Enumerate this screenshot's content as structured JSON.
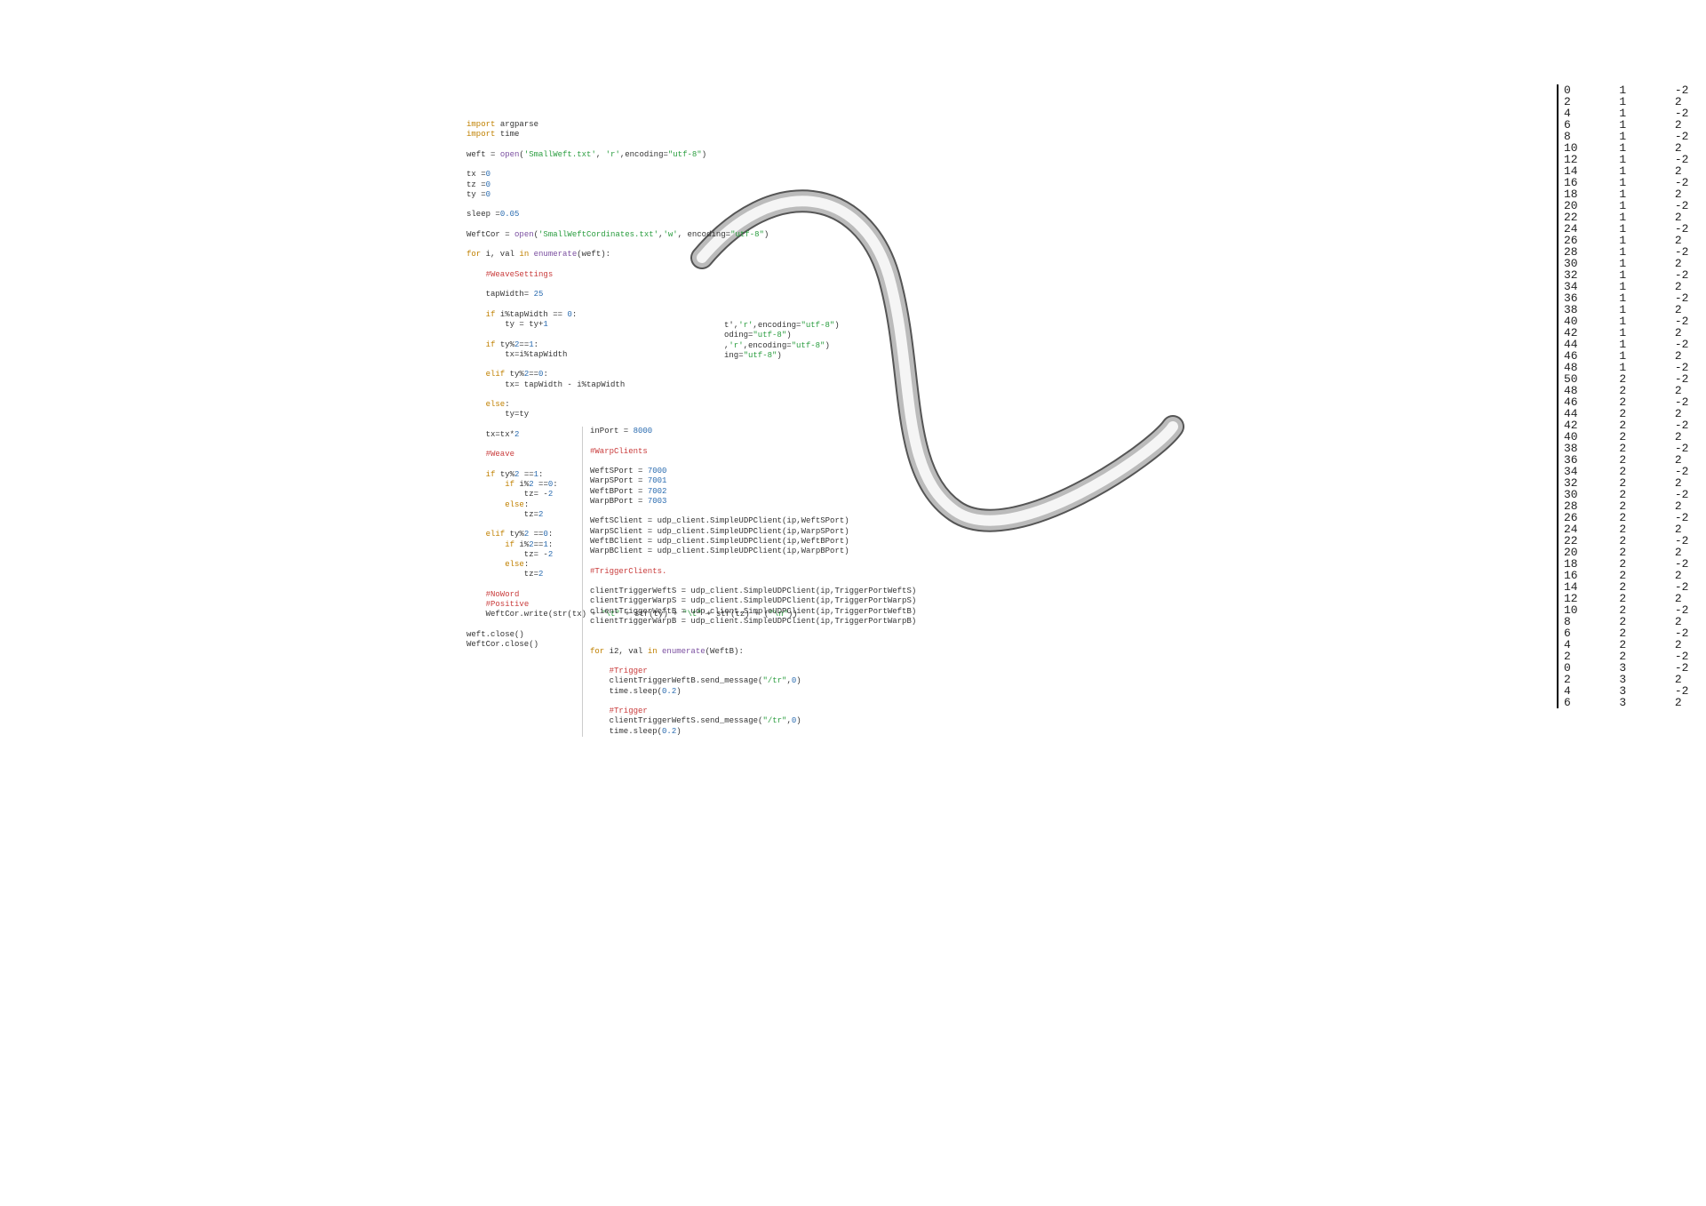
{
  "code_left": {
    "lines": [
      {
        "segs": [
          {
            "t": "import ",
            "c": "kw"
          },
          {
            "t": "argparse"
          }
        ]
      },
      {
        "segs": [
          {
            "t": "import ",
            "c": "kw"
          },
          {
            "t": "time"
          }
        ]
      },
      {
        "segs": [
          {
            "t": ""
          }
        ]
      },
      {
        "segs": [
          {
            "t": "weft = "
          },
          {
            "t": "open",
            "c": "fn"
          },
          {
            "t": "("
          },
          {
            "t": "'SmallWeft.txt'",
            "c": "st"
          },
          {
            "t": ", "
          },
          {
            "t": "'r'",
            "c": "st"
          },
          {
            "t": ",encoding="
          },
          {
            "t": "\"utf-8\"",
            "c": "st"
          },
          {
            "t": ")"
          }
        ]
      },
      {
        "segs": [
          {
            "t": ""
          }
        ]
      },
      {
        "segs": [
          {
            "t": "tx ="
          },
          {
            "t": "0",
            "c": "nm"
          }
        ]
      },
      {
        "segs": [
          {
            "t": "tz ="
          },
          {
            "t": "0",
            "c": "nm"
          }
        ]
      },
      {
        "segs": [
          {
            "t": "ty ="
          },
          {
            "t": "0",
            "c": "nm"
          }
        ]
      },
      {
        "segs": [
          {
            "t": ""
          }
        ]
      },
      {
        "segs": [
          {
            "t": "sleep ="
          },
          {
            "t": "0.05",
            "c": "nm"
          }
        ]
      },
      {
        "segs": [
          {
            "t": ""
          }
        ]
      },
      {
        "segs": [
          {
            "t": "WeftCor = "
          },
          {
            "t": "open",
            "c": "fn"
          },
          {
            "t": "("
          },
          {
            "t": "'SmallWeftCordinates.txt'",
            "c": "st"
          },
          {
            "t": ","
          },
          {
            "t": "'w'",
            "c": "st"
          },
          {
            "t": ", encoding="
          },
          {
            "t": "\"utf-8\"",
            "c": "st"
          },
          {
            "t": ")"
          }
        ]
      },
      {
        "segs": [
          {
            "t": ""
          }
        ]
      },
      {
        "segs": [
          {
            "t": "for ",
            "c": "kw"
          },
          {
            "t": "i, val "
          },
          {
            "t": "in ",
            "c": "kw"
          },
          {
            "t": "enumerate",
            "c": "fn"
          },
          {
            "t": "(weft):"
          }
        ]
      },
      {
        "segs": [
          {
            "t": ""
          }
        ]
      },
      {
        "segs": [
          {
            "t": "    "
          },
          {
            "t": "#WeaveSettings",
            "c": "cm"
          }
        ]
      },
      {
        "segs": [
          {
            "t": ""
          }
        ]
      },
      {
        "segs": [
          {
            "t": "    tapWidth= "
          },
          {
            "t": "25",
            "c": "nm"
          }
        ]
      },
      {
        "segs": [
          {
            "t": ""
          }
        ]
      },
      {
        "segs": [
          {
            "t": "    "
          },
          {
            "t": "if ",
            "c": "kw"
          },
          {
            "t": "i%tapWidth == "
          },
          {
            "t": "0",
            "c": "nm"
          },
          {
            "t": ":"
          }
        ]
      },
      {
        "segs": [
          {
            "t": "        ty = ty+"
          },
          {
            "t": "1",
            "c": "nm"
          }
        ]
      },
      {
        "segs": [
          {
            "t": ""
          }
        ]
      },
      {
        "segs": [
          {
            "t": "    "
          },
          {
            "t": "if ",
            "c": "kw"
          },
          {
            "t": "ty%"
          },
          {
            "t": "2",
            "c": "nm"
          },
          {
            "t": "=="
          },
          {
            "t": "1",
            "c": "nm"
          },
          {
            "t": ":"
          }
        ]
      },
      {
        "segs": [
          {
            "t": "        tx=i%tapWidth"
          }
        ]
      },
      {
        "segs": [
          {
            "t": ""
          }
        ]
      },
      {
        "segs": [
          {
            "t": "    "
          },
          {
            "t": "elif ",
            "c": "kw"
          },
          {
            "t": "ty%"
          },
          {
            "t": "2",
            "c": "nm"
          },
          {
            "t": "=="
          },
          {
            "t": "0",
            "c": "nm"
          },
          {
            "t": ":"
          }
        ]
      },
      {
        "segs": [
          {
            "t": "        tx= tapWidth - i%tapWidth"
          }
        ]
      },
      {
        "segs": [
          {
            "t": ""
          }
        ]
      },
      {
        "segs": [
          {
            "t": "    "
          },
          {
            "t": "else",
            "c": "kw"
          },
          {
            "t": ":"
          }
        ]
      },
      {
        "segs": [
          {
            "t": "        ty=ty"
          }
        ]
      },
      {
        "segs": [
          {
            "t": ""
          }
        ]
      },
      {
        "segs": [
          {
            "t": "    tx=tx*"
          },
          {
            "t": "2",
            "c": "nm"
          }
        ]
      },
      {
        "segs": [
          {
            "t": ""
          }
        ]
      },
      {
        "segs": [
          {
            "t": "    "
          },
          {
            "t": "#Weave",
            "c": "cm"
          }
        ]
      },
      {
        "segs": [
          {
            "t": ""
          }
        ]
      },
      {
        "segs": [
          {
            "t": "    "
          },
          {
            "t": "if ",
            "c": "kw"
          },
          {
            "t": "ty%"
          },
          {
            "t": "2",
            "c": "nm"
          },
          {
            "t": " =="
          },
          {
            "t": "1",
            "c": "nm"
          },
          {
            "t": ":"
          }
        ]
      },
      {
        "segs": [
          {
            "t": "        "
          },
          {
            "t": "if ",
            "c": "kw"
          },
          {
            "t": "i%"
          },
          {
            "t": "2",
            "c": "nm"
          },
          {
            "t": " =="
          },
          {
            "t": "0",
            "c": "nm"
          },
          {
            "t": ":"
          }
        ]
      },
      {
        "segs": [
          {
            "t": "            tz= -"
          },
          {
            "t": "2",
            "c": "nm"
          }
        ]
      },
      {
        "segs": [
          {
            "t": "        "
          },
          {
            "t": "else",
            "c": "kw"
          },
          {
            "t": ":"
          }
        ]
      },
      {
        "segs": [
          {
            "t": "            tz="
          },
          {
            "t": "2",
            "c": "nm"
          }
        ]
      },
      {
        "segs": [
          {
            "t": ""
          }
        ]
      },
      {
        "segs": [
          {
            "t": "    "
          },
          {
            "t": "elif ",
            "c": "kw"
          },
          {
            "t": "ty%"
          },
          {
            "t": "2",
            "c": "nm"
          },
          {
            "t": " =="
          },
          {
            "t": "0",
            "c": "nm"
          },
          {
            "t": ":"
          }
        ]
      },
      {
        "segs": [
          {
            "t": "        "
          },
          {
            "t": "if ",
            "c": "kw"
          },
          {
            "t": "i%"
          },
          {
            "t": "2",
            "c": "nm"
          },
          {
            "t": "=="
          },
          {
            "t": "1",
            "c": "nm"
          },
          {
            "t": ":"
          }
        ]
      },
      {
        "segs": [
          {
            "t": "            tz= -"
          },
          {
            "t": "2",
            "c": "nm"
          }
        ]
      },
      {
        "segs": [
          {
            "t": "        "
          },
          {
            "t": "else",
            "c": "kw"
          },
          {
            "t": ":"
          }
        ]
      },
      {
        "segs": [
          {
            "t": "            tz="
          },
          {
            "t": "2",
            "c": "nm"
          }
        ]
      },
      {
        "segs": [
          {
            "t": ""
          }
        ]
      },
      {
        "segs": [
          {
            "t": "    "
          },
          {
            "t": "#NoWord",
            "c": "cm"
          }
        ]
      },
      {
        "segs": [
          {
            "t": "    "
          },
          {
            "t": "#Positive",
            "c": "cm"
          }
        ]
      },
      {
        "segs": [
          {
            "t": "    WeftCor.write(str(tx) + "
          },
          {
            "t": "\"\\t\"",
            "c": "st"
          },
          {
            "t": " + str(ty) + "
          },
          {
            "t": "\"\\t\"",
            "c": "st"
          },
          {
            "t": " + str(tz) + ("
          },
          {
            "t": "\"\\n\"",
            "c": "st"
          },
          {
            "t": "))"
          }
        ]
      },
      {
        "segs": [
          {
            "t": ""
          }
        ]
      },
      {
        "segs": [
          {
            "t": "weft.close()"
          }
        ]
      },
      {
        "segs": [
          {
            "t": "WeftCor.close()"
          }
        ]
      }
    ]
  },
  "snippet_right": {
    "lines": [
      {
        "segs": [
          {
            "t": "t'",
            "c": "pl"
          },
          {
            "t": ",",
            "c": "pl"
          },
          {
            "t": "'r'",
            "c": "st"
          },
          {
            "t": ",encoding=",
            "c": "pl"
          },
          {
            "t": "\"utf-8\"",
            "c": "st"
          },
          {
            "t": ")",
            "c": "pl"
          }
        ]
      },
      {
        "segs": [
          {
            "t": "oding=",
            "c": "pl"
          },
          {
            "t": "\"utf-8\"",
            "c": "st"
          },
          {
            "t": ")",
            "c": "pl"
          }
        ]
      },
      {
        "segs": [
          {
            "t": ",",
            "c": "pl"
          },
          {
            "t": "'r'",
            "c": "st"
          },
          {
            "t": ",encoding=",
            "c": "pl"
          },
          {
            "t": "\"utf-8\"",
            "c": "st"
          },
          {
            "t": ")",
            "c": "pl"
          }
        ]
      },
      {
        "segs": [
          {
            "t": "ing=",
            "c": "pl"
          },
          {
            "t": "\"utf-8\"",
            "c": "st"
          },
          {
            "t": ")",
            "c": "pl"
          }
        ]
      }
    ]
  },
  "code_bottom": {
    "lines": [
      {
        "segs": [
          {
            "t": "inPort = "
          },
          {
            "t": "8000",
            "c": "nm"
          }
        ]
      },
      {
        "segs": [
          {
            "t": ""
          }
        ]
      },
      {
        "segs": [
          {
            "t": "#WarpClients",
            "c": "cm"
          }
        ]
      },
      {
        "segs": [
          {
            "t": ""
          }
        ]
      },
      {
        "segs": [
          {
            "t": "WeftSPort = "
          },
          {
            "t": "7000",
            "c": "nm"
          }
        ]
      },
      {
        "segs": [
          {
            "t": "WarpSPort = "
          },
          {
            "t": "7001",
            "c": "nm"
          }
        ]
      },
      {
        "segs": [
          {
            "t": "WeftBPort = "
          },
          {
            "t": "7002",
            "c": "nm"
          }
        ]
      },
      {
        "segs": [
          {
            "t": "WarpBPort = "
          },
          {
            "t": "7003",
            "c": "nm"
          }
        ]
      },
      {
        "segs": [
          {
            "t": ""
          }
        ]
      },
      {
        "segs": [
          {
            "t": "WeftSClient = udp_client.SimpleUDPClient(ip,WeftSPort)"
          }
        ]
      },
      {
        "segs": [
          {
            "t": "WarpSClient = udp_client.SimpleUDPClient(ip,WarpSPort)"
          }
        ]
      },
      {
        "segs": [
          {
            "t": "WeftBClient = udp_client.SimpleUDPClient(ip,WeftBPort)"
          }
        ]
      },
      {
        "segs": [
          {
            "t": "WarpBClient = udp_client.SimpleUDPClient(ip,WarpBPort)"
          }
        ]
      },
      {
        "segs": [
          {
            "t": ""
          }
        ]
      },
      {
        "segs": [
          {
            "t": "#TriggerClients.",
            "c": "cm"
          }
        ]
      },
      {
        "segs": [
          {
            "t": ""
          }
        ]
      },
      {
        "segs": [
          {
            "t": "clientTriggerWeftS = udp_client.SimpleUDPClient(ip,TriggerPortWeftS)"
          }
        ]
      },
      {
        "segs": [
          {
            "t": "clientTriggerWarpS = udp_client.SimpleUDPClient(ip,TriggerPortWarpS)"
          }
        ]
      },
      {
        "segs": [
          {
            "t": "clientTriggerWeftB = udp_client.SimpleUDPClient(ip,TriggerPortWeftB)"
          }
        ]
      },
      {
        "segs": [
          {
            "t": "clientTriggerWarpB = udp_client.SimpleUDPClient(ip,TriggerPortWarpB)"
          }
        ]
      },
      {
        "segs": [
          {
            "t": ""
          }
        ]
      },
      {
        "segs": [
          {
            "t": ""
          }
        ]
      },
      {
        "segs": [
          {
            "t": "for ",
            "c": "kw"
          },
          {
            "t": "i2, val "
          },
          {
            "t": "in ",
            "c": "kw"
          },
          {
            "t": "enumerate",
            "c": "fn"
          },
          {
            "t": "(WeftB):"
          }
        ]
      },
      {
        "segs": [
          {
            "t": ""
          }
        ]
      },
      {
        "segs": [
          {
            "t": "    "
          },
          {
            "t": "#Trigger",
            "c": "cm"
          }
        ]
      },
      {
        "segs": [
          {
            "t": "    clientTriggerWeftB.send_message("
          },
          {
            "t": "\"/tr\"",
            "c": "st"
          },
          {
            "t": ","
          },
          {
            "t": "0",
            "c": "nm"
          },
          {
            "t": ")"
          }
        ]
      },
      {
        "segs": [
          {
            "t": "    time.sleep("
          },
          {
            "t": "0.2",
            "c": "nm"
          },
          {
            "t": ")"
          }
        ]
      },
      {
        "segs": [
          {
            "t": ""
          }
        ]
      },
      {
        "segs": [
          {
            "t": "    "
          },
          {
            "t": "#Trigger",
            "c": "cm"
          }
        ]
      },
      {
        "segs": [
          {
            "t": "    clientTriggerWeftS.send_message("
          },
          {
            "t": "\"/tr\"",
            "c": "st"
          },
          {
            "t": ","
          },
          {
            "t": "0",
            "c": "nm"
          },
          {
            "t": ")"
          }
        ]
      },
      {
        "segs": [
          {
            "t": "    time.sleep("
          },
          {
            "t": "0.2",
            "c": "nm"
          },
          {
            "t": ")"
          }
        ]
      }
    ]
  },
  "table": {
    "rows": [
      [
        0,
        1,
        -2
      ],
      [
        2,
        1,
        2
      ],
      [
        4,
        1,
        -2
      ],
      [
        6,
        1,
        2
      ],
      [
        8,
        1,
        -2
      ],
      [
        10,
        1,
        2
      ],
      [
        12,
        1,
        -2
      ],
      [
        14,
        1,
        2
      ],
      [
        16,
        1,
        -2
      ],
      [
        18,
        1,
        2
      ],
      [
        20,
        1,
        -2
      ],
      [
        22,
        1,
        2
      ],
      [
        24,
        1,
        -2
      ],
      [
        26,
        1,
        2
      ],
      [
        28,
        1,
        -2
      ],
      [
        30,
        1,
        2
      ],
      [
        32,
        1,
        -2
      ],
      [
        34,
        1,
        2
      ],
      [
        36,
        1,
        -2
      ],
      [
        38,
        1,
        2
      ],
      [
        40,
        1,
        -2
      ],
      [
        42,
        1,
        2
      ],
      [
        44,
        1,
        -2
      ],
      [
        46,
        1,
        2
      ],
      [
        48,
        1,
        -2
      ],
      [
        50,
        2,
        -2
      ],
      [
        48,
        2,
        2
      ],
      [
        46,
        2,
        -2
      ],
      [
        44,
        2,
        2
      ],
      [
        42,
        2,
        -2
      ],
      [
        40,
        2,
        2
      ],
      [
        38,
        2,
        -2
      ],
      [
        36,
        2,
        2
      ],
      [
        34,
        2,
        -2
      ],
      [
        32,
        2,
        2
      ],
      [
        30,
        2,
        -2
      ],
      [
        28,
        2,
        2
      ],
      [
        26,
        2,
        -2
      ],
      [
        24,
        2,
        2
      ],
      [
        22,
        2,
        -2
      ],
      [
        20,
        2,
        2
      ],
      [
        18,
        2,
        -2
      ],
      [
        16,
        2,
        2
      ],
      [
        14,
        2,
        -2
      ],
      [
        12,
        2,
        2
      ],
      [
        10,
        2,
        -2
      ],
      [
        8,
        2,
        2
      ],
      [
        6,
        2,
        -2
      ],
      [
        4,
        2,
        2
      ],
      [
        2,
        2,
        -2
      ],
      [
        0,
        3,
        -2
      ],
      [
        2,
        3,
        2
      ],
      [
        4,
        3,
        -2
      ],
      [
        6,
        3,
        2
      ]
    ]
  }
}
